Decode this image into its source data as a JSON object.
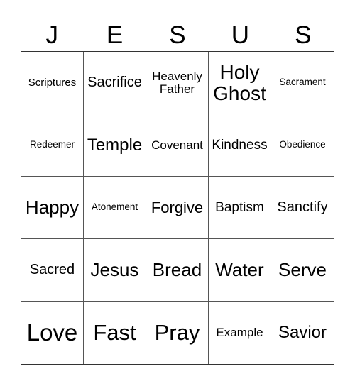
{
  "header": {
    "letters": [
      "J",
      "E",
      "S",
      "U",
      "S"
    ]
  },
  "cells": [
    "Scriptures",
    "Sacrifice",
    "Heavenly Father",
    "Holy Ghost",
    "Sacrament",
    "Redeemer",
    "Temple",
    "Covenant",
    "Kindness",
    "Obedience",
    "Happy",
    "Atonement",
    "Forgive",
    "Baptism",
    "Sanctify",
    "Sacred",
    "Jesus",
    "Bread",
    "Water",
    "Serve",
    "Love",
    "Fast",
    "Pray",
    "Example",
    "Savior"
  ]
}
